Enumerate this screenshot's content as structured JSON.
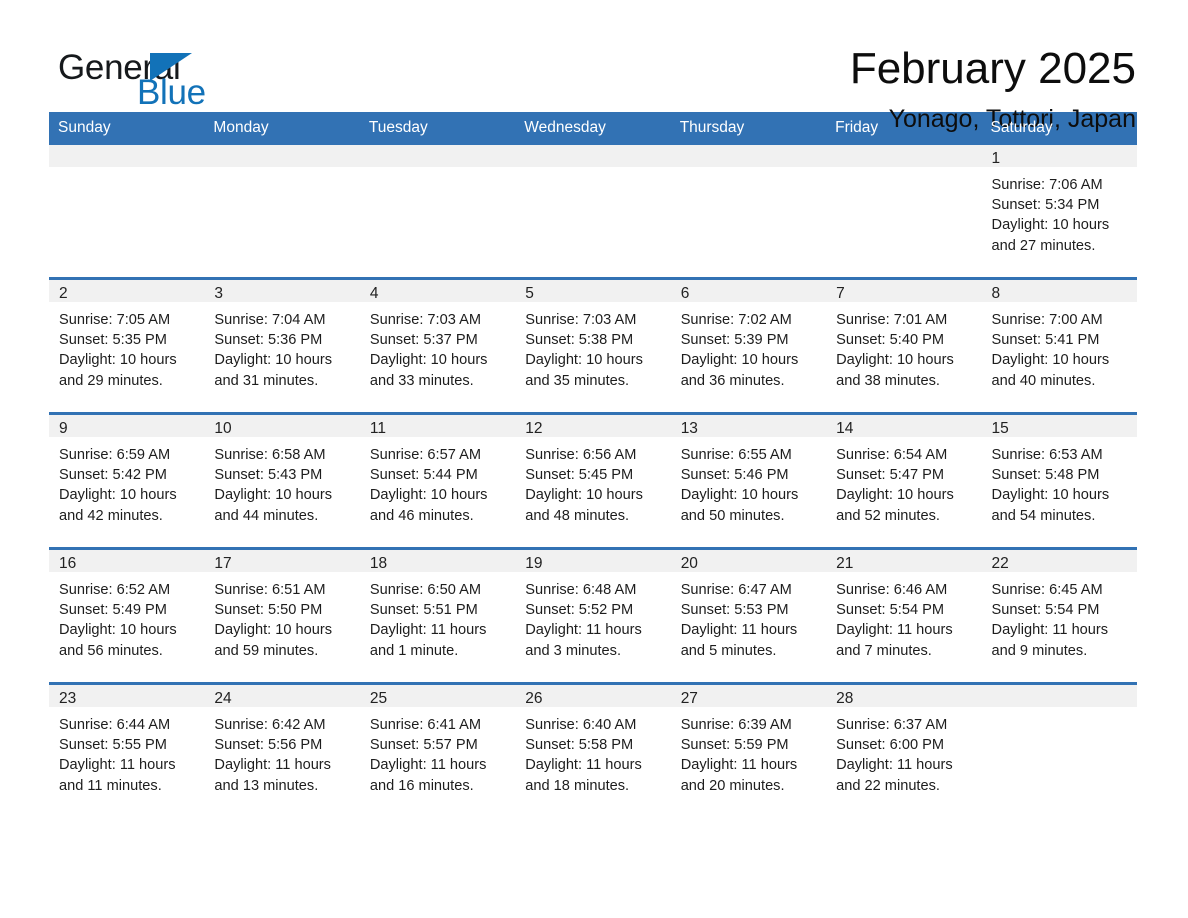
{
  "logo": {
    "word_black": "General",
    "word_blue": "Blue",
    "triangle_color": "#1272b8"
  },
  "header": {
    "title": "February 2025",
    "subtitle": "Yonago, Tottori, Japan"
  },
  "theme": {
    "header_blue": "#3272b4",
    "daynum_gray": "#f1f1f1",
    "text": "#1d1d1d"
  },
  "weekday_headers": [
    "Sunday",
    "Monday",
    "Tuesday",
    "Wednesday",
    "Thursday",
    "Friday",
    "Saturday"
  ],
  "weeks": [
    [
      {
        "day": "",
        "blank": true
      },
      {
        "day": "",
        "blank": true
      },
      {
        "day": "",
        "blank": true
      },
      {
        "day": "",
        "blank": true
      },
      {
        "day": "",
        "blank": true
      },
      {
        "day": "",
        "blank": true
      },
      {
        "day": "1",
        "sunrise": "Sunrise: 7:06 AM",
        "sunset": "Sunset: 5:34 PM",
        "daylight": "Daylight: 10 hours and 27 minutes."
      }
    ],
    [
      {
        "day": "2",
        "sunrise": "Sunrise: 7:05 AM",
        "sunset": "Sunset: 5:35 PM",
        "daylight": "Daylight: 10 hours and 29 minutes."
      },
      {
        "day": "3",
        "sunrise": "Sunrise: 7:04 AM",
        "sunset": "Sunset: 5:36 PM",
        "daylight": "Daylight: 10 hours and 31 minutes."
      },
      {
        "day": "4",
        "sunrise": "Sunrise: 7:03 AM",
        "sunset": "Sunset: 5:37 PM",
        "daylight": "Daylight: 10 hours and 33 minutes."
      },
      {
        "day": "5",
        "sunrise": "Sunrise: 7:03 AM",
        "sunset": "Sunset: 5:38 PM",
        "daylight": "Daylight: 10 hours and 35 minutes."
      },
      {
        "day": "6",
        "sunrise": "Sunrise: 7:02 AM",
        "sunset": "Sunset: 5:39 PM",
        "daylight": "Daylight: 10 hours and 36 minutes."
      },
      {
        "day": "7",
        "sunrise": "Sunrise: 7:01 AM",
        "sunset": "Sunset: 5:40 PM",
        "daylight": "Daylight: 10 hours and 38 minutes."
      },
      {
        "day": "8",
        "sunrise": "Sunrise: 7:00 AM",
        "sunset": "Sunset: 5:41 PM",
        "daylight": "Daylight: 10 hours and 40 minutes."
      }
    ],
    [
      {
        "day": "9",
        "sunrise": "Sunrise: 6:59 AM",
        "sunset": "Sunset: 5:42 PM",
        "daylight": "Daylight: 10 hours and 42 minutes."
      },
      {
        "day": "10",
        "sunrise": "Sunrise: 6:58 AM",
        "sunset": "Sunset: 5:43 PM",
        "daylight": "Daylight: 10 hours and 44 minutes."
      },
      {
        "day": "11",
        "sunrise": "Sunrise: 6:57 AM",
        "sunset": "Sunset: 5:44 PM",
        "daylight": "Daylight: 10 hours and 46 minutes."
      },
      {
        "day": "12",
        "sunrise": "Sunrise: 6:56 AM",
        "sunset": "Sunset: 5:45 PM",
        "daylight": "Daylight: 10 hours and 48 minutes."
      },
      {
        "day": "13",
        "sunrise": "Sunrise: 6:55 AM",
        "sunset": "Sunset: 5:46 PM",
        "daylight": "Daylight: 10 hours and 50 minutes."
      },
      {
        "day": "14",
        "sunrise": "Sunrise: 6:54 AM",
        "sunset": "Sunset: 5:47 PM",
        "daylight": "Daylight: 10 hours and 52 minutes."
      },
      {
        "day": "15",
        "sunrise": "Sunrise: 6:53 AM",
        "sunset": "Sunset: 5:48 PM",
        "daylight": "Daylight: 10 hours and 54 minutes."
      }
    ],
    [
      {
        "day": "16",
        "sunrise": "Sunrise: 6:52 AM",
        "sunset": "Sunset: 5:49 PM",
        "daylight": "Daylight: 10 hours and 56 minutes."
      },
      {
        "day": "17",
        "sunrise": "Sunrise: 6:51 AM",
        "sunset": "Sunset: 5:50 PM",
        "daylight": "Daylight: 10 hours and 59 minutes."
      },
      {
        "day": "18",
        "sunrise": "Sunrise: 6:50 AM",
        "sunset": "Sunset: 5:51 PM",
        "daylight": "Daylight: 11 hours and 1 minute."
      },
      {
        "day": "19",
        "sunrise": "Sunrise: 6:48 AM",
        "sunset": "Sunset: 5:52 PM",
        "daylight": "Daylight: 11 hours and 3 minutes."
      },
      {
        "day": "20",
        "sunrise": "Sunrise: 6:47 AM",
        "sunset": "Sunset: 5:53 PM",
        "daylight": "Daylight: 11 hours and 5 minutes."
      },
      {
        "day": "21",
        "sunrise": "Sunrise: 6:46 AM",
        "sunset": "Sunset: 5:54 PM",
        "daylight": "Daylight: 11 hours and 7 minutes."
      },
      {
        "day": "22",
        "sunrise": "Sunrise: 6:45 AM",
        "sunset": "Sunset: 5:54 PM",
        "daylight": "Daylight: 11 hours and 9 minutes."
      }
    ],
    [
      {
        "day": "23",
        "sunrise": "Sunrise: 6:44 AM",
        "sunset": "Sunset: 5:55 PM",
        "daylight": "Daylight: 11 hours and 11 minutes."
      },
      {
        "day": "24",
        "sunrise": "Sunrise: 6:42 AM",
        "sunset": "Sunset: 5:56 PM",
        "daylight": "Daylight: 11 hours and 13 minutes."
      },
      {
        "day": "25",
        "sunrise": "Sunrise: 6:41 AM",
        "sunset": "Sunset: 5:57 PM",
        "daylight": "Daylight: 11 hours and 16 minutes."
      },
      {
        "day": "26",
        "sunrise": "Sunrise: 6:40 AM",
        "sunset": "Sunset: 5:58 PM",
        "daylight": "Daylight: 11 hours and 18 minutes."
      },
      {
        "day": "27",
        "sunrise": "Sunrise: 6:39 AM",
        "sunset": "Sunset: 5:59 PM",
        "daylight": "Daylight: 11 hours and 20 minutes."
      },
      {
        "day": "28",
        "sunrise": "Sunrise: 6:37 AM",
        "sunset": "Sunset: 6:00 PM",
        "daylight": "Daylight: 11 hours and 22 minutes."
      },
      {
        "day": "",
        "blank": true
      }
    ]
  ]
}
